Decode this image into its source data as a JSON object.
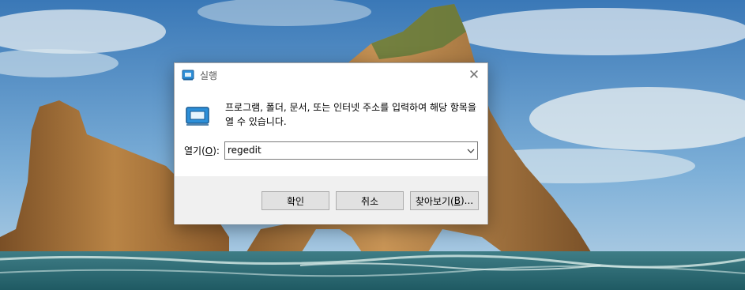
{
  "dialog": {
    "title": "실행",
    "close_glyph": "✕",
    "description": "프로그램, 폴더, 문서, 또는 인터넷 주소를 입력하여 해당 항목을 열 수 있습니다.",
    "open_label_prefix": "열기(",
    "open_label_key": "O",
    "open_label_suffix": "):",
    "command_value": "regedit",
    "ok_label": "확인",
    "cancel_label": "취소",
    "browse_label_prefix": "찾아보기(",
    "browse_label_key": "B",
    "browse_label_suffix": ")..."
  },
  "icons": {
    "title": "run-icon",
    "main": "run-icon",
    "close": "close-icon",
    "dropdown": "chevron-down-icon"
  },
  "colors": {
    "sky_top": "#3f7fbf",
    "sky_bottom": "#a9cbe6",
    "sea": "#2f6f7a",
    "rock": "#a4733c",
    "footer": "#f0f0f0",
    "button": "#e1e1e1"
  }
}
